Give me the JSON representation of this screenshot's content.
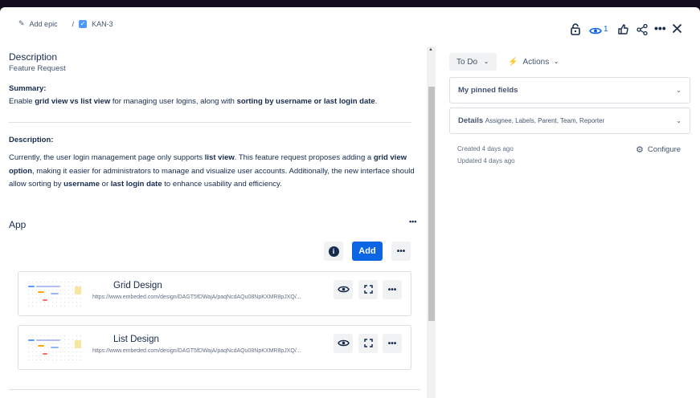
{
  "breadcrumb": {
    "add_epic": "Add epic",
    "separator": "/",
    "issue_key": "KAN-3"
  },
  "header": {
    "watch_count": "1",
    "icons": [
      "lock-icon",
      "eye-icon",
      "thumbs-up-icon",
      "share-icon",
      "more-icon",
      "close-icon"
    ]
  },
  "description": {
    "heading": "Description",
    "subtitle": "Feature Request",
    "summary_label": "Summary:",
    "summary": [
      "Enable ",
      "grid view vs list view",
      " for managing user logins, along with ",
      "sorting by username or last login date",
      "."
    ],
    "desc_label": "Description:",
    "desc": [
      "Currently, the user login management page only supports ",
      "list view",
      ". This feature request proposes adding a ",
      "grid view option",
      ", making it easier for administrators to manage and visualize user accounts. Additionally, the new interface should allow sorting by ",
      "username",
      " or ",
      "last login date",
      " to enhance usability and efficiency."
    ]
  },
  "app": {
    "heading": "App",
    "add_label": "Add",
    "items": [
      {
        "title": "Grid Design",
        "url": "https://www.embeded.com/design/DAGT5fDWajA/paqNcdAQu08NpKXMR8pJXQ/..."
      },
      {
        "title": "List Design",
        "url": "https://www.embeded.com/design/DAGT5fDWajA/paqNcdAQu08NpKXMR8pJXQ/..."
      }
    ]
  },
  "side": {
    "status": "To Do",
    "actions": "Actions",
    "pinned": "My pinned fields",
    "details_label": "Details",
    "details_fields": "Assignee, Labels, Parent, Team, Reporter",
    "created": "Created 4 days ago",
    "updated": "Updated 4 days ago",
    "configure": "Configure"
  },
  "colors": {
    "primary": "#0c66e4",
    "watch": "#0c66e4"
  }
}
